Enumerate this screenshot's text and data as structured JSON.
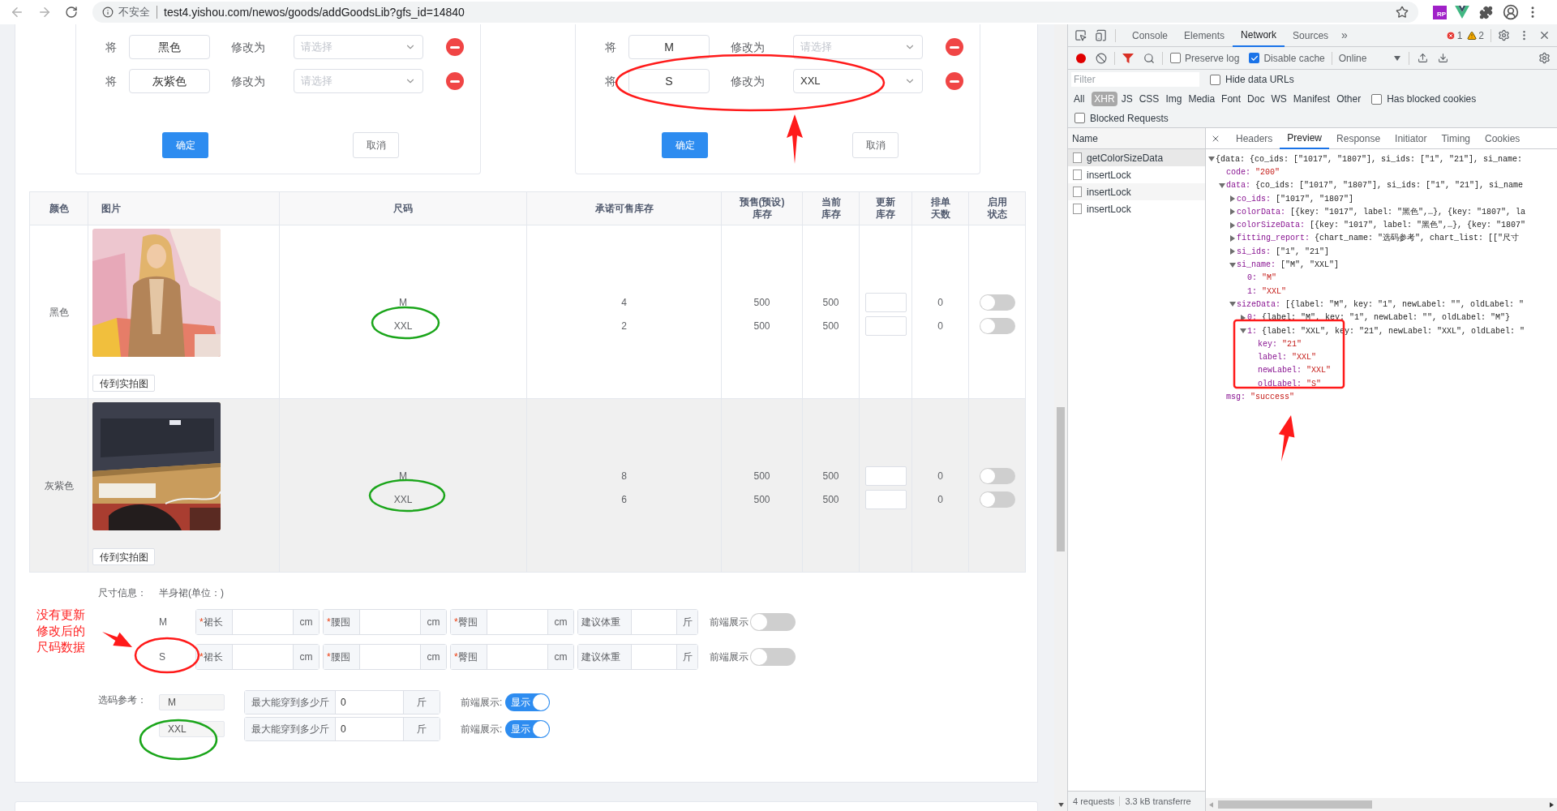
{
  "browser": {
    "security": "不安全",
    "url": "test4.yishou.com/newos/goods/addGoodsLib?gfs_id=14840",
    "extension_badge": "RP"
  },
  "rename_panels": [
    {
      "rows": [
        {
          "prefix": "将",
          "from": "黑色",
          "to_label": "修改为",
          "placeholder": "请选择"
        },
        {
          "prefix": "将",
          "from": "灰紫色",
          "to_label": "修改为",
          "placeholder": "请选择"
        }
      ],
      "confirm": "确定",
      "cancel": "取消"
    },
    {
      "rows": [
        {
          "prefix": "将",
          "from": "M",
          "to_label": "修改为",
          "placeholder": "请选择"
        },
        {
          "prefix": "将",
          "from": "S",
          "to_label": "修改为",
          "value": "XXL"
        }
      ],
      "confirm": "确定",
      "cancel": "取消"
    }
  ],
  "table": {
    "columns": [
      [
        "颜色"
      ],
      [
        "图片"
      ],
      [
        "尺码"
      ],
      [
        "承诺可售库存"
      ],
      [
        "预售(预设)",
        "库存"
      ],
      [
        "当前",
        "库存"
      ],
      [
        "更新",
        "库存"
      ],
      [
        "排单",
        "天数"
      ],
      [
        "启用",
        "状态"
      ]
    ],
    "rows": [
      {
        "color_name": "黑色",
        "upload": "传到实拍图",
        "hovered": false,
        "sizes": [
          {
            "size": "M",
            "promised": "4",
            "presale": "500",
            "current": "500",
            "queue": "0",
            "enabled": false
          },
          {
            "size": "XXL",
            "promised": "2",
            "presale": "500",
            "current": "500",
            "queue": "0",
            "enabled": false
          }
        ]
      },
      {
        "color_name": "灰紫色",
        "upload": "传到实拍图",
        "hovered": true,
        "sizes": [
          {
            "size": "M",
            "promised": "8",
            "presale": "500",
            "current": "500",
            "queue": "0",
            "enabled": false
          },
          {
            "size": "XXL",
            "promised": "6",
            "presale": "500",
            "current": "500",
            "queue": "0",
            "enabled": false
          }
        ]
      }
    ]
  },
  "size_info": {
    "label": "尺寸信息：",
    "category": "半身裙(单位：)",
    "rows": [
      {
        "size": "M",
        "fields": [
          {
            "mark": "*",
            "label": "裙长",
            "unit": "cm"
          },
          {
            "mark": "*",
            "label": "腰围",
            "unit": "cm"
          },
          {
            "mark": "*",
            "label": "臀围",
            "unit": "cm"
          },
          {
            "label": "建议体重",
            "unit": "斤"
          }
        ],
        "show_label": "前端展示",
        "on": false
      },
      {
        "size": "S",
        "fields": [
          {
            "mark": "*",
            "label": "裙长",
            "unit": "cm"
          },
          {
            "mark": "*",
            "label": "腰围",
            "unit": "cm"
          },
          {
            "mark": "*",
            "label": "臀围",
            "unit": "cm"
          },
          {
            "label": "建议体重",
            "unit": "斤"
          }
        ],
        "show_label": "前端展示",
        "on": false
      }
    ]
  },
  "fitting": {
    "label": "选码参考：",
    "rows": [
      {
        "size": "M",
        "field_label": "最大能穿到多少斤",
        "value": "0",
        "unit": "斤",
        "show_label": "前端展示:",
        "on": true,
        "on_text": "显示"
      },
      {
        "size": "XXL",
        "field_label": "最大能穿到多少斤",
        "value": "0",
        "unit": "斤",
        "show_label": "前端展示:",
        "on": true,
        "on_text": "显示"
      }
    ]
  },
  "annotation_note": [
    "没有更新",
    "修改后的",
    "尺码数据"
  ],
  "devtools": {
    "tabs": [
      {
        "label": "Console",
        "selected": false
      },
      {
        "label": "Elements",
        "selected": false
      },
      {
        "label": "Network",
        "selected": true
      },
      {
        "label": "Sources",
        "selected": false
      }
    ],
    "more_tabs": "»",
    "errors": "1",
    "warnings": "2",
    "preserve_log": {
      "label": "Preserve log",
      "checked": false
    },
    "disable_cache": {
      "label": "Disable cache",
      "checked": true
    },
    "throttle": "Online",
    "filter_placeholder": "Filter",
    "hide_data_urls": {
      "label": "Hide data URLs",
      "checked": false
    },
    "types": [
      {
        "label": "All",
        "selected": false
      },
      {
        "label": "XHR",
        "selected": true
      },
      {
        "label": "JS",
        "selected": false
      },
      {
        "label": "CSS",
        "selected": false
      },
      {
        "label": "Img",
        "selected": false
      },
      {
        "label": "Media",
        "selected": false
      },
      {
        "label": "Font",
        "selected": false
      },
      {
        "label": "Doc",
        "selected": false
      },
      {
        "label": "WS",
        "selected": false
      },
      {
        "label": "Manifest",
        "selected": false
      },
      {
        "label": "Other",
        "selected": false
      }
    ],
    "has_blocked_cookies": {
      "label": "Has blocked cookies",
      "checked": false
    },
    "blocked_requests": {
      "label": "Blocked Requests",
      "checked": false
    },
    "name_header": "Name",
    "requests": [
      {
        "name": "getColorSizeData",
        "selected": true
      },
      {
        "name": "insertLock",
        "selected": false
      },
      {
        "name": "insertLock",
        "selected": false
      },
      {
        "name": "insertLock",
        "selected": false
      }
    ],
    "detail_tabs": [
      {
        "label": "Headers",
        "selected": false
      },
      {
        "label": "Preview",
        "selected": true
      },
      {
        "label": "Response",
        "selected": false
      },
      {
        "label": "Initiator",
        "selected": false
      },
      {
        "label": "Timing",
        "selected": false
      },
      {
        "label": "Cookies",
        "selected": false
      }
    ],
    "preview": [
      {
        "value": "{data: {co_ids: [\"1017\", \"1807\"], si_ids: [\"1\", \"21\"], si_name:",
        "kind": "summary",
        "expanded": true,
        "children": [
          {
            "key": "code:",
            "value": "\"200\"",
            "kind": "string"
          },
          {
            "key": "data:",
            "value": "{co_ids: [\"1017\", \"1807\"], si_ids: [\"1\", \"21\"], si_name",
            "kind": "summary",
            "expanded": true,
            "children": [
              {
                "key": "co_ids:",
                "value": "[\"1017\", \"1807\"]",
                "kind": "summary",
                "expanded": false
              },
              {
                "key": "colorData:",
                "value": "[{key: \"1017\", label: \"黑色\",…}, {key: \"1807\", la",
                "kind": "summary",
                "expanded": false
              },
              {
                "key": "colorSizeData:",
                "value": "[{key: \"1017\", label: \"黑色\",…}, {key: \"1807\"",
                "kind": "summary",
                "expanded": false
              },
              {
                "key": "fitting_report:",
                "value": "{chart_name: \"选码参考\", chart_list: [[\"尺寸",
                "kind": "summary",
                "expanded": false
              },
              {
                "key": "si_ids:",
                "value": "[\"1\", \"21\"]",
                "kind": "summary",
                "expanded": false
              },
              {
                "key": "si_name:",
                "value": "[\"M\", \"XXL\"]",
                "kind": "summary",
                "expanded": true,
                "children": [
                  {
                    "key": "0:",
                    "value": "\"M\"",
                    "kind": "string"
                  },
                  {
                    "key": "1:",
                    "value": "\"XXL\"",
                    "kind": "string"
                  }
                ]
              },
              {
                "key": "sizeData:",
                "value": "[{label: \"M\", key: \"1\", newLabel: \"\", oldLabel: \"",
                "kind": "summary",
                "expanded": true,
                "children": [
                  {
                    "key": "0:",
                    "value": "{label: \"M\", key: \"1\", newLabel: \"\", oldLabel: \"M\"}",
                    "kind": "summary",
                    "expanded": false
                  },
                  {
                    "key": "1:",
                    "value": "{label: \"XXL\", key: \"21\", newLabel: \"XXL\", oldLabel: \"",
                    "kind": "summary",
                    "expanded": true,
                    "children": [
                      {
                        "key": "key:",
                        "value": "\"21\"",
                        "kind": "string"
                      },
                      {
                        "key": "label:",
                        "value": "\"XXL\"",
                        "kind": "string"
                      },
                      {
                        "key": "newLabel:",
                        "value": "\"XXL\"",
                        "kind": "string"
                      },
                      {
                        "key": "oldLabel:",
                        "value": "\"S\"",
                        "kind": "string"
                      }
                    ]
                  }
                ]
              }
            ]
          },
          {
            "key": "msg:",
            "value": "\"success\"",
            "kind": "string"
          }
        ]
      }
    ],
    "status": [
      "4 requests",
      "3.3 kB transferre"
    ]
  }
}
